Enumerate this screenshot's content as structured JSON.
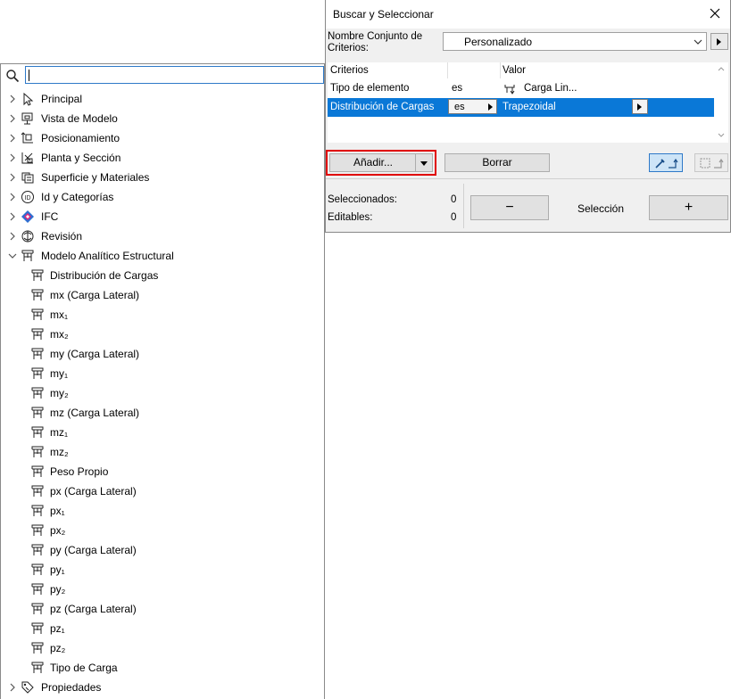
{
  "tree": {
    "search": {
      "value": "",
      "placeholder": ""
    },
    "items": [
      {
        "label": "Principal",
        "icon": "cursor-arrow-icon",
        "level": 0,
        "state": "collapsed"
      },
      {
        "label": "Vista de Modelo",
        "icon": "model-view-icon",
        "level": 0,
        "state": "collapsed"
      },
      {
        "label": "Posicionamiento",
        "icon": "positioning-icon",
        "level": 0,
        "state": "collapsed"
      },
      {
        "label": "Planta y Sección",
        "icon": "floor-plan-icon",
        "level": 0,
        "state": "collapsed"
      },
      {
        "label": "Superficie y Materiales",
        "icon": "surface-materials-icon",
        "level": 0,
        "state": "collapsed"
      },
      {
        "label": "Id y Categorías",
        "icon": "id-circle-icon",
        "level": 0,
        "state": "collapsed"
      },
      {
        "label": "IFC",
        "icon": "ifc-logo-icon",
        "level": 0,
        "state": "collapsed"
      },
      {
        "label": "Revisión",
        "icon": "revision-icon",
        "level": 0,
        "state": "collapsed"
      },
      {
        "label": "Modelo Analítico Estructural",
        "icon": "structural-load-icon",
        "level": 0,
        "state": "expanded"
      },
      {
        "label": "Distribución de Cargas",
        "icon": "structural-load-icon",
        "level": 1
      },
      {
        "label": "mx (Carga Lateral)",
        "icon": "structural-load-icon",
        "level": 1
      },
      {
        "label": "mx₁",
        "icon": "structural-load-icon",
        "level": 1
      },
      {
        "label": "mx₂",
        "icon": "structural-load-icon",
        "level": 1
      },
      {
        "label": "my (Carga Lateral)",
        "icon": "structural-load-icon",
        "level": 1
      },
      {
        "label": "my₁",
        "icon": "structural-load-icon",
        "level": 1
      },
      {
        "label": "my₂",
        "icon": "structural-load-icon",
        "level": 1
      },
      {
        "label": "mz (Carga Lateral)",
        "icon": "structural-load-icon",
        "level": 1
      },
      {
        "label": "mz₁",
        "icon": "structural-load-icon",
        "level": 1
      },
      {
        "label": "mz₂",
        "icon": "structural-load-icon",
        "level": 1
      },
      {
        "label": "Peso Propio",
        "icon": "structural-load-icon",
        "level": 1
      },
      {
        "label": "px (Carga Lateral)",
        "icon": "structural-load-icon",
        "level": 1
      },
      {
        "label": "px₁",
        "icon": "structural-load-icon",
        "level": 1
      },
      {
        "label": "px₂",
        "icon": "structural-load-icon",
        "level": 1
      },
      {
        "label": "py (Carga Lateral)",
        "icon": "structural-load-icon",
        "level": 1
      },
      {
        "label": "py₁",
        "icon": "structural-load-icon",
        "level": 1
      },
      {
        "label": "py₂",
        "icon": "structural-load-icon",
        "level": 1
      },
      {
        "label": "pz (Carga Lateral)",
        "icon": "structural-load-icon",
        "level": 1
      },
      {
        "label": "pz₁",
        "icon": "structural-load-icon",
        "level": 1
      },
      {
        "label": "pz₂",
        "icon": "structural-load-icon",
        "level": 1
      },
      {
        "label": "Tipo de Carga",
        "icon": "structural-load-icon",
        "level": 1
      },
      {
        "label": "Propiedades",
        "icon": "tags-icon",
        "level": 0,
        "state": "collapsed"
      }
    ]
  },
  "dialog": {
    "title": "Buscar y Seleccionar",
    "criteria_set_label": "Nombre Conjunto de Criterios:",
    "criteria_set_value": "Personalizado",
    "table": {
      "headers": [
        "Criterios",
        "",
        "Valor"
      ],
      "rows": [
        {
          "criterion": "Tipo de elemento",
          "operator": "es",
          "value": "Carga Lin...",
          "value_icon": "line-load-icon",
          "selected": false
        },
        {
          "criterion": "Distribución de Cargas",
          "operator": "es",
          "value": "Trapezoidal",
          "selected": true
        }
      ]
    },
    "add_label": "Añadir...",
    "clear_label": "Borrar",
    "selected_label": "Seleccionados:",
    "selected_count": "0",
    "editable_label": "Editables:",
    "editable_count": "0",
    "deselect_label": "−",
    "selection_label": "Selección",
    "select_label": "+",
    "colors": {
      "accent": "#0a78d7",
      "highlight_border": "#e00000"
    }
  }
}
